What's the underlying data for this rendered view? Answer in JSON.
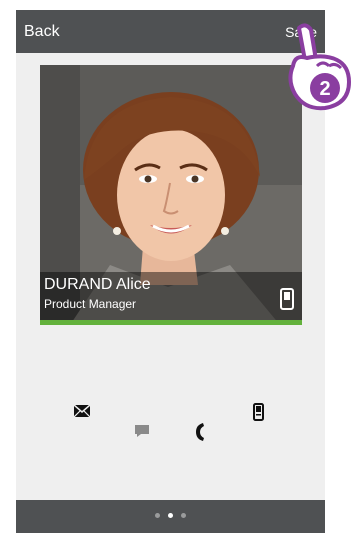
{
  "header": {
    "back_label": "Back",
    "save_label": "Save"
  },
  "contact": {
    "name": "DURAND Alice",
    "title": "Product Manager"
  },
  "actions": [
    "envelope-icon",
    "message-icon",
    "phone-icon",
    "mobile-phone-icon"
  ],
  "pagination": {
    "pages": 3,
    "active_index": 1
  },
  "step_badge": {
    "number": "2"
  },
  "colors": {
    "header_bg": "#4f5153",
    "accent_green": "#63b13c",
    "badge_purple": "#8a3ea0"
  }
}
